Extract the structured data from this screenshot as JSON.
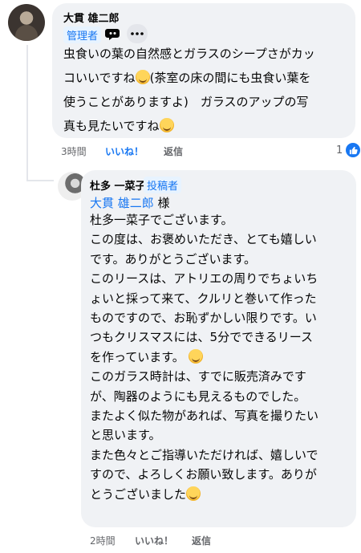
{
  "comment": {
    "author": "大貫 雄二郎",
    "admin_label": "管理者",
    "text_lines": [
      "虫食いの葉の自然感とガラスのシープさがカッ",
      "コいいですね",
      "使うことがありますよ)　ガラスのアップの写",
      "真も見たいですね"
    ],
    "line2_suffix": "(茶室の床の間にも虫食い葉を",
    "time": "3時間",
    "like_label": "いいね！",
    "reply_label": "返信",
    "reaction_count": "1"
  },
  "reply": {
    "author": "杜多 一菜子",
    "author_badge": "投稿者",
    "mention": "大貫 雄二郎",
    "mention_suffix": " 様",
    "lines": [
      "杜多一菜子でございます。",
      "この度は、お褒めいただき、とても嬉しい",
      "です。ありがとうございます。",
      "このリースは、アトリエの周りでちょいち",
      "ょいと採って来て、クルリと巻いて作った",
      "ものですので、お恥ずかしい限りです。い",
      "つもクリスマスには、5分でできるリース",
      "を作っています。",
      "このガラス時計は、すでに販売済みです",
      "が、陶器のようにも見えるものでした。",
      "またよく似た物があれば、写真を撮りたい",
      "と思います。",
      "また色々とご指導いただければ、嬉しいで",
      "すので、よろしくお願い致します。ありが",
      "とうございました"
    ],
    "time": "2時間",
    "like_label": "いいね！",
    "reply_label": "返信"
  },
  "icons": {
    "badge": "conversation-badge-icon",
    "more": "more-options-icon",
    "reaction": "thumbs-up-icon",
    "emoji": "smiling-face-emoji"
  },
  "colors": {
    "link": "#1877f2",
    "bubble": "#f0f2f5",
    "meta": "#65676b"
  }
}
